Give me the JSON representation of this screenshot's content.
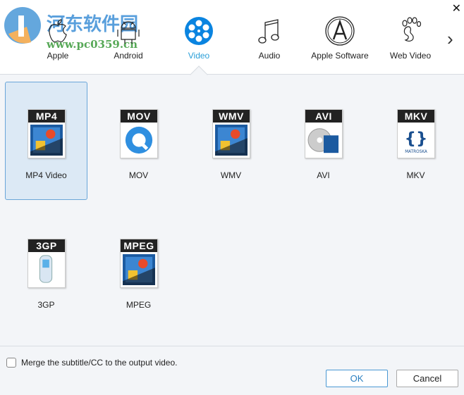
{
  "watermark": {
    "cn": "河东软件园",
    "url": "www.pc0359.cn"
  },
  "tabs": [
    {
      "label": "Apple",
      "icon": "apple-icon"
    },
    {
      "label": "Android",
      "icon": "android-icon"
    },
    {
      "label": "Video",
      "icon": "film-reel-icon",
      "active": true
    },
    {
      "label": "Audio",
      "icon": "music-note-icon"
    },
    {
      "label": "Apple Software",
      "icon": "app-store-icon"
    },
    {
      "label": "Web Video",
      "icon": "foot-icon"
    }
  ],
  "formats": [
    {
      "tag": "MP4",
      "name": "MP4 Video",
      "selected": true
    },
    {
      "tag": "MOV",
      "name": "MOV"
    },
    {
      "tag": "WMV",
      "name": "WMV"
    },
    {
      "tag": "AVI",
      "name": "AVI"
    },
    {
      "tag": "MKV",
      "name": "MKV"
    },
    {
      "tag": "3GP",
      "name": "3GP"
    },
    {
      "tag": "MPEG",
      "name": "MPEG"
    }
  ],
  "footer": {
    "merge_label": "Merge the subtitle/CC to the output video.",
    "merge_checked": false,
    "ok": "OK",
    "cancel": "Cancel"
  },
  "colors": {
    "accent": "#2a9fd8",
    "selected_bg": "#dce9f5",
    "video_icon": "#0a84e0"
  }
}
